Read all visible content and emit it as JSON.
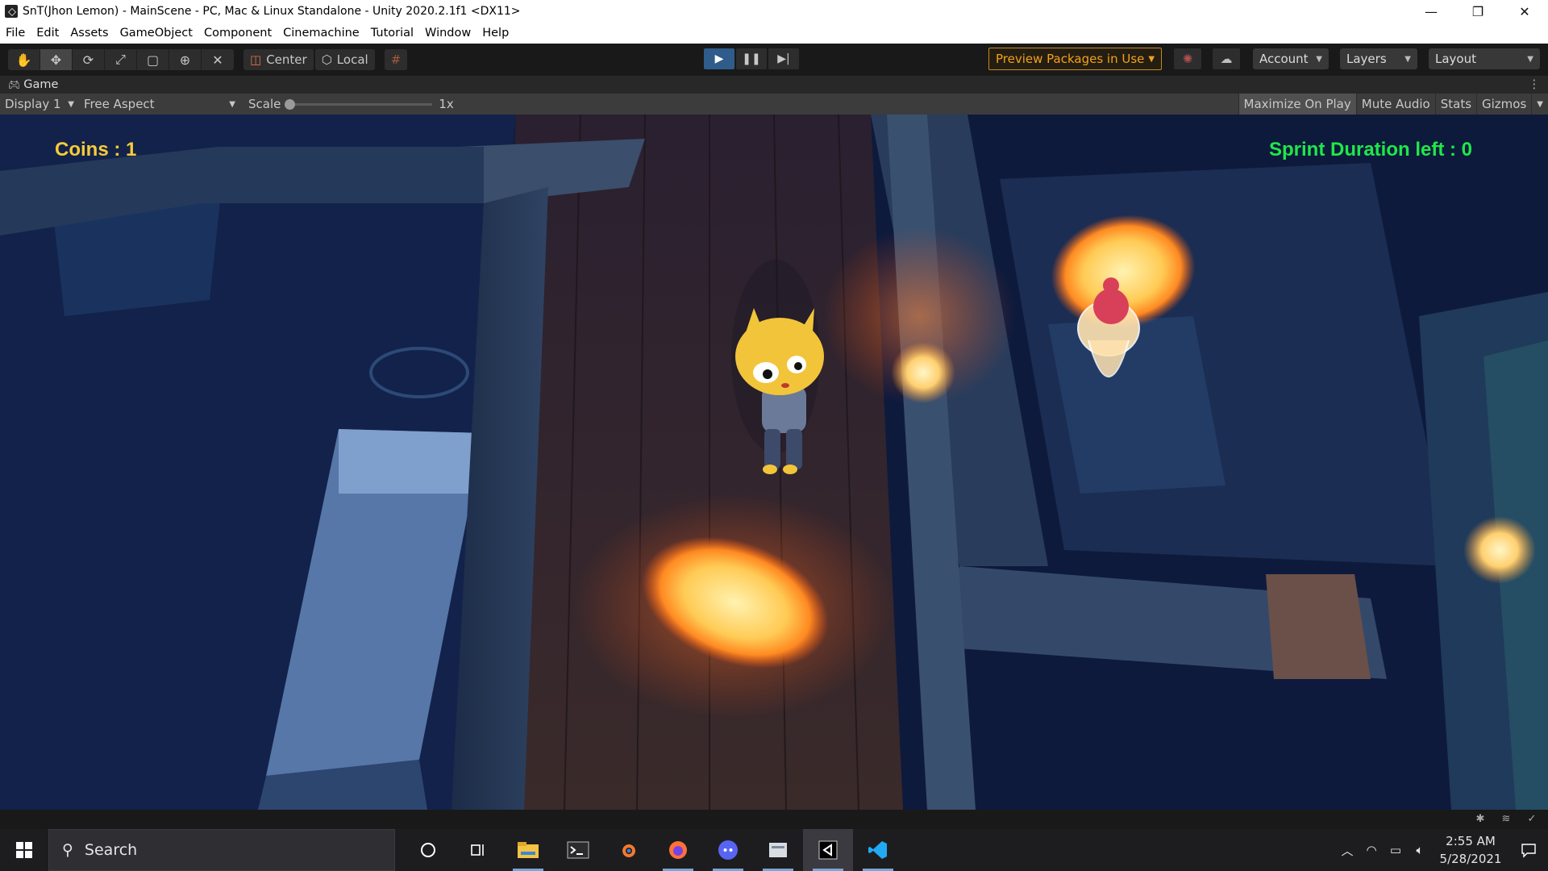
{
  "window": {
    "title": "SnT(Jhon Lemon) - MainScene - PC, Mac & Linux Standalone - Unity 2020.2.1f1 <DX11>",
    "controls": {
      "minimize": "—",
      "maximize": "❐",
      "close": "✕"
    }
  },
  "menu": [
    "File",
    "Edit",
    "Assets",
    "GameObject",
    "Component",
    "Cinemachine",
    "Tutorial",
    "Window",
    "Help"
  ],
  "toolbar": {
    "tools": [
      "hand-tool-icon",
      "move-tool-icon",
      "rotate-tool-icon",
      "scale-tool-icon",
      "rect-tool-icon",
      "transform-tool-icon",
      "custom-tool-icon"
    ],
    "active_tool": "move-tool-icon",
    "pivot_label": "Center",
    "space_label": "Local",
    "preview_packages_label": "Preview Packages in Use",
    "account_label": "Account",
    "layers_label": "Layers",
    "layout_label": "Layout",
    "accent_color": "#f3a21a",
    "play_active_color": "#2f5c8a"
  },
  "game_tab": {
    "title": "Game"
  },
  "game_toolbar": {
    "display": "Display 1",
    "aspect": "Free Aspect",
    "scale_label": "Scale",
    "scale_value": "1x",
    "maximize_on_play": "Maximize On Play",
    "mute_audio": "Mute Audio",
    "stats": "Stats",
    "gizmos": "Gizmos"
  },
  "hud": {
    "coins": "Coins : 1",
    "sprint": "Sprint Duration left : 0",
    "coins_color": "#f7cb3a",
    "sprint_color": "#1ee84a"
  },
  "taskbar": {
    "search_placeholder": "Search",
    "apps": [
      "cortana-icon",
      "task-view-icon",
      "file-explorer-icon",
      "terminal-icon",
      "blender-icon",
      "firefox-icon",
      "discord-icon",
      "app-icon",
      "unity-icon",
      "vscode-icon"
    ],
    "time": "2:55 AM",
    "date": "5/28/2021"
  }
}
